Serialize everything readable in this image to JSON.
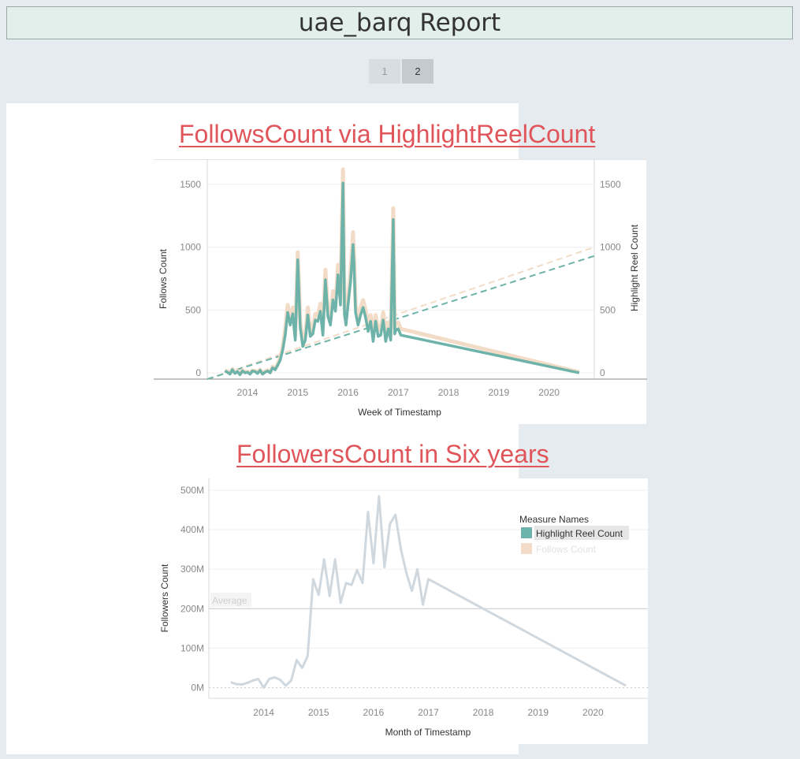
{
  "report": {
    "title": "uae_barq Report"
  },
  "pager": {
    "pages": [
      "1",
      "2"
    ],
    "current": "2"
  },
  "colors": {
    "teal": "#6db3a9",
    "peach": "#f3dcc7",
    "gray_line": "#d0d8df",
    "title_red": "#e0555a"
  },
  "chart_data": [
    {
      "type": "line",
      "title": "FollowsCount via HighlightReelCount",
      "xlabel": "Week of Timestamp",
      "ylabel_left": "Follows Count",
      "ylabel_right": "Highlight Reel Count",
      "x_ticks": [
        "2014",
        "2015",
        "2016",
        "2017",
        "2018",
        "2019",
        "2020"
      ],
      "y_ticks": [
        "0",
        "500",
        "1000",
        "1500"
      ],
      "ylim": [
        -50,
        1700
      ],
      "xlim": [
        2013.2,
        2020.9
      ],
      "series": [
        {
          "name": "Follows Count",
          "color": "#f3dcc7",
          "x": [
            2013.55,
            2013.6,
            2013.65,
            2013.7,
            2013.75,
            2013.8,
            2013.85,
            2013.9,
            2013.95,
            2014.0,
            2014.05,
            2014.1,
            2014.15,
            2014.2,
            2014.25,
            2014.3,
            2014.35,
            2014.4,
            2014.45,
            2014.5,
            2014.55,
            2014.6,
            2014.65,
            2014.7,
            2014.75,
            2014.8,
            2014.85,
            2014.9,
            2014.95,
            2015.0,
            2015.05,
            2015.1,
            2015.15,
            2015.2,
            2015.25,
            2015.3,
            2015.35,
            2015.4,
            2015.45,
            2015.5,
            2015.55,
            2015.6,
            2015.65,
            2015.7,
            2015.75,
            2015.8,
            2015.85,
            2015.9,
            2015.93,
            2015.96,
            2016.0,
            2016.05,
            2016.1,
            2016.12,
            2016.15,
            2016.2,
            2016.25,
            2016.3,
            2016.35,
            2016.4,
            2016.45,
            2016.5,
            2016.55,
            2016.6,
            2016.65,
            2016.7,
            2016.75,
            2016.8,
            2016.85,
            2016.9,
            2016.93,
            2016.95,
            2017.0,
            2017.05,
            2020.6
          ],
          "y": [
            20,
            10,
            -5,
            30,
            0,
            15,
            -10,
            20,
            5,
            10,
            -5,
            20,
            15,
            0,
            25,
            -5,
            10,
            20,
            5,
            50,
            30,
            70,
            120,
            200,
            350,
            540,
            420,
            520,
            300,
            960,
            400,
            250,
            300,
            520,
            330,
            350,
            470,
            460,
            550,
            350,
            820,
            500,
            420,
            650,
            550,
            860,
            600,
            1620,
            520,
            430,
            600,
            800,
            1120,
            950,
            540,
            430,
            520,
            580,
            500,
            380,
            460,
            300,
            460,
            340,
            350,
            480,
            300,
            400,
            300,
            1310,
            360,
            390,
            400,
            350,
            5
          ]
        },
        {
          "name": "Highlight Reel Count",
          "color": "#6db3a9",
          "x": [
            2013.55,
            2013.6,
            2013.65,
            2013.7,
            2013.75,
            2013.8,
            2013.85,
            2013.9,
            2013.95,
            2014.0,
            2014.05,
            2014.1,
            2014.15,
            2014.2,
            2014.25,
            2014.3,
            2014.35,
            2014.4,
            2014.45,
            2014.5,
            2014.55,
            2014.6,
            2014.65,
            2014.7,
            2014.75,
            2014.8,
            2014.85,
            2014.9,
            2014.95,
            2015.0,
            2015.05,
            2015.1,
            2015.15,
            2015.2,
            2015.25,
            2015.3,
            2015.35,
            2015.4,
            2015.45,
            2015.5,
            2015.55,
            2015.6,
            2015.65,
            2015.7,
            2015.75,
            2015.8,
            2015.85,
            2015.9,
            2015.93,
            2015.96,
            2016.0,
            2016.05,
            2016.1,
            2016.12,
            2016.15,
            2016.2,
            2016.25,
            2016.3,
            2016.35,
            2016.4,
            2016.45,
            2016.5,
            2016.55,
            2016.6,
            2016.65,
            2016.7,
            2016.75,
            2016.8,
            2016.85,
            2016.9,
            2016.93,
            2016.95,
            2017.0,
            2017.05,
            2020.6
          ],
          "y": [
            15,
            5,
            -10,
            25,
            -5,
            10,
            -15,
            15,
            0,
            5,
            -10,
            15,
            10,
            -5,
            20,
            -10,
            5,
            15,
            0,
            40,
            25,
            60,
            100,
            180,
            300,
            480,
            380,
            470,
            260,
            900,
            360,
            210,
            260,
            460,
            290,
            310,
            420,
            410,
            490,
            300,
            740,
            450,
            380,
            580,
            490,
            780,
            540,
            1510,
            460,
            380,
            540,
            720,
            1020,
            860,
            480,
            380,
            460,
            520,
            440,
            330,
            410,
            250,
            410,
            290,
            300,
            420,
            250,
            350,
            260,
            1220,
            310,
            340,
            350,
            300,
            0
          ]
        }
      ],
      "trend_lines": [
        {
          "name": "Follows Count trend",
          "color": "#f3dcc7",
          "x": [
            2013.2,
            2020.9
          ],
          "y": [
            -50,
            1000
          ]
        },
        {
          "name": "Highlight Reel Count trend",
          "color": "#6db3a9",
          "x": [
            2013.2,
            2020.9
          ],
          "y": [
            -50,
            930
          ]
        }
      ]
    },
    {
      "type": "line",
      "title": "FollowersCount in Six years",
      "xlabel": "Month of Timestamp",
      "ylabel": "Followers Count",
      "x_ticks": [
        "2014",
        "2015",
        "2016",
        "2017",
        "2018",
        "2019",
        "2020"
      ],
      "y_ticks": [
        "0M",
        "100M",
        "200M",
        "300M",
        "400M",
        "500M"
      ],
      "ylim": [
        -5,
        510
      ],
      "xlim": [
        2013.0,
        2021.0
      ],
      "reference_line": {
        "label": "Average",
        "value": 200
      },
      "legend": {
        "title": "Measure Names",
        "items": [
          "Highlight Reel Count",
          "Follows Count"
        ],
        "position": "top-right"
      },
      "series": [
        {
          "name": "Followers Count",
          "color": "#d0d8df",
          "x": [
            2013.4,
            2013.5,
            2013.6,
            2013.7,
            2013.8,
            2013.9,
            2014.0,
            2014.1,
            2014.2,
            2014.3,
            2014.4,
            2014.5,
            2014.6,
            2014.7,
            2014.8,
            2014.9,
            2015.0,
            2015.1,
            2015.2,
            2015.3,
            2015.4,
            2015.5,
            2015.6,
            2015.7,
            2015.8,
            2015.9,
            2016.0,
            2016.1,
            2016.2,
            2016.3,
            2016.4,
            2016.5,
            2016.6,
            2016.7,
            2016.8,
            2016.9,
            2017.0,
            2020.6
          ],
          "y": [
            14,
            9,
            8,
            12,
            18,
            22,
            0,
            22,
            26,
            20,
            5,
            18,
            70,
            50,
            80,
            275,
            235,
            325,
            232,
            325,
            215,
            265,
            260,
            298,
            265,
            445,
            315,
            485,
            305,
            415,
            438,
            350,
            290,
            245,
            300,
            210,
            275,
            5
          ]
        }
      ]
    }
  ]
}
